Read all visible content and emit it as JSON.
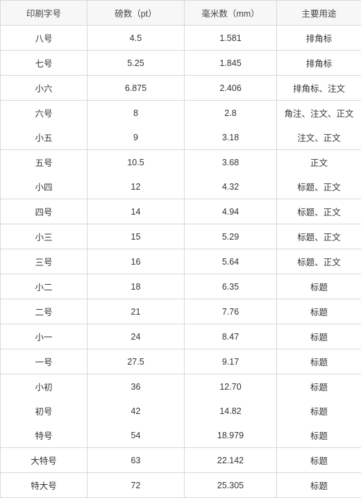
{
  "headers": {
    "col1": "印刷字号",
    "col2": "磅数（pt）",
    "col3": "毫米数（mm）",
    "col4": "主要用途"
  },
  "chart_data": {
    "type": "table",
    "columns": [
      "印刷字号",
      "磅数（pt）",
      "毫米数（mm）",
      "主要用途"
    ],
    "rows": [
      {
        "name": "八号",
        "pt": "4.5",
        "mm": "1.581",
        "use": "排角标"
      },
      {
        "name": "七号",
        "pt": "5.25",
        "mm": "1.845",
        "use": "排角标"
      },
      {
        "name": "小六",
        "pt": "6.875",
        "mm": "2.406",
        "use": "排角标、注文"
      },
      {
        "name": "六号",
        "pt": "8",
        "mm": "2.8",
        "use": "角注、注文、正文"
      },
      {
        "name": "小五",
        "pt": "9",
        "mm": "3.18",
        "use": "注文、正文"
      },
      {
        "name": "五号",
        "pt": "10.5",
        "mm": "3.68",
        "use": "正文"
      },
      {
        "name": "小四",
        "pt": "12",
        "mm": "4.32",
        "use": "标题、正文"
      },
      {
        "name": "四号",
        "pt": "14",
        "mm": "4.94",
        "use": "标题、正文"
      },
      {
        "name": "小三",
        "pt": "15",
        "mm": "5.29",
        "use": "标题、正文"
      },
      {
        "name": "三号",
        "pt": "16",
        "mm": "5.64",
        "use": "标题、正文"
      },
      {
        "name": "小二",
        "pt": "18",
        "mm": "6.35",
        "use": "标题"
      },
      {
        "name": "二号",
        "pt": "21",
        "mm": "7.76",
        "use": "标题"
      },
      {
        "name": "小一",
        "pt": "24",
        "mm": "8.47",
        "use": "标题"
      },
      {
        "name": "一号",
        "pt": "27.5",
        "mm": "9.17",
        "use": "标题"
      },
      {
        "name": "小初",
        "pt": "36",
        "mm": "12.70",
        "use": "标题"
      },
      {
        "name": "初号",
        "pt": "42",
        "mm": "14.82",
        "use": "标题"
      },
      {
        "name": "特号",
        "pt": "54",
        "mm": "18.979",
        "use": "标题"
      },
      {
        "name": "大特号",
        "pt": "63",
        "mm": "22.142",
        "use": "标题"
      },
      {
        "name": "特大号",
        "pt": "72",
        "mm": "25.305",
        "use": "标题"
      }
    ],
    "group_breaks": [
      0,
      1,
      2,
      3,
      5,
      7,
      8,
      9,
      10,
      11,
      12,
      13,
      14,
      17,
      18
    ]
  }
}
